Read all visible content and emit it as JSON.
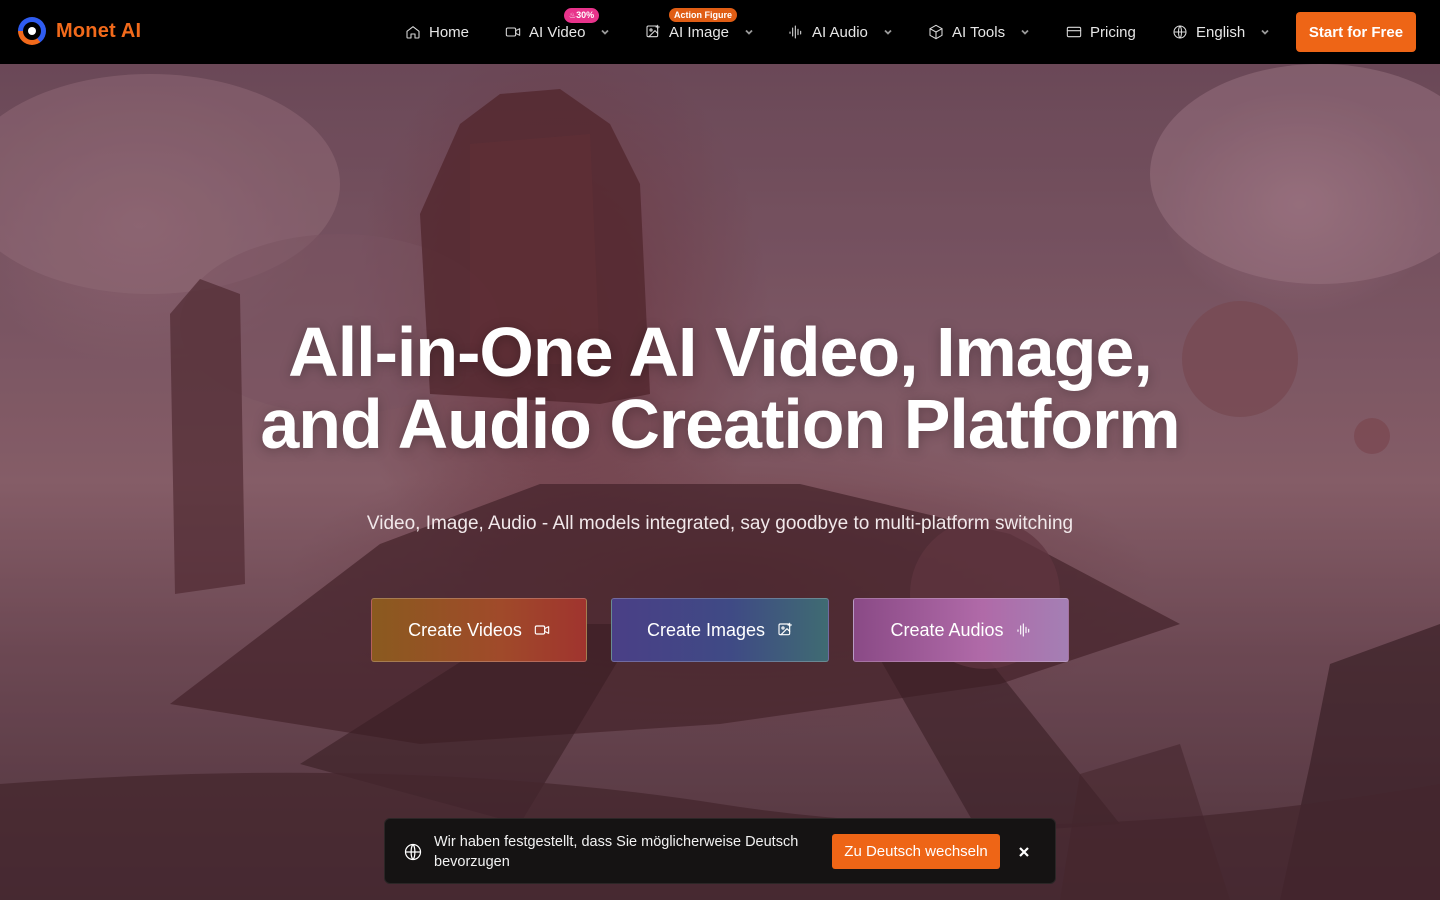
{
  "brand": {
    "name": "Monet AI",
    "accent": "#ee6516"
  },
  "nav": {
    "items": [
      {
        "label": "Home",
        "icon": "home-icon"
      },
      {
        "label": "AI Video",
        "icon": "video-camera-icon",
        "badge": "30%",
        "has_dropdown": true
      },
      {
        "label": "AI Image",
        "icon": "image-plus-icon",
        "badge": "Action Figure",
        "has_dropdown": true
      },
      {
        "label": "AI Audio",
        "icon": "audio-wave-icon",
        "has_dropdown": true
      },
      {
        "label": "AI Tools",
        "icon": "cube-icon",
        "has_dropdown": true
      },
      {
        "label": "Pricing",
        "icon": "credit-card-icon"
      },
      {
        "label": "English",
        "icon": "globe-icon",
        "has_dropdown": true
      }
    ],
    "cta": "Start for Free"
  },
  "hero": {
    "title_line1": "All-in-One AI Video, Image,",
    "title_line2": "and Audio Creation Platform",
    "subtitle": "Video, Image, Audio - All models integrated, say goodbye to multi-platform switching",
    "buttons": {
      "videos": "Create Videos",
      "images": "Create Images",
      "audios": "Create Audios"
    }
  },
  "language_toast": {
    "message": "Wir haben festgestellt, dass Sie möglicherweise Deutsch bevorzugen",
    "action": "Zu Deutsch wechseln",
    "icon": "globe-icon"
  }
}
